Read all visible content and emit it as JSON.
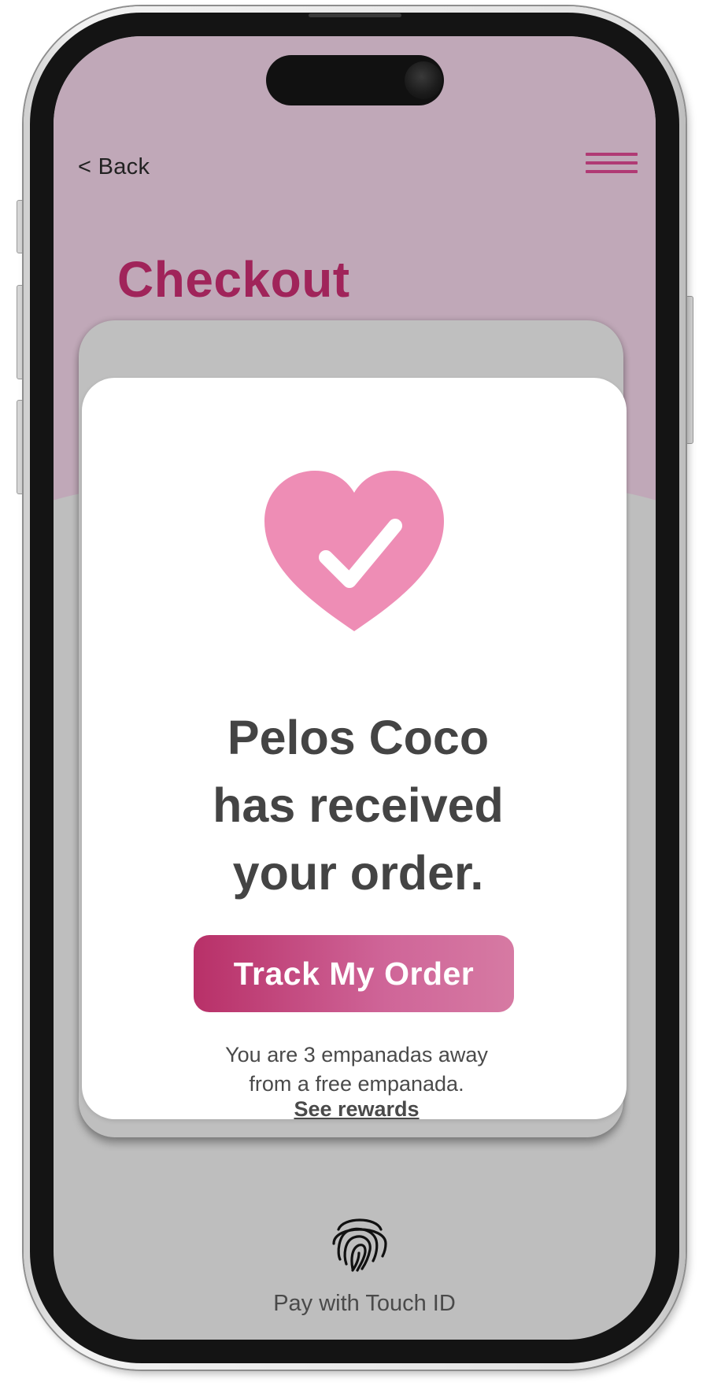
{
  "colors": {
    "header_bg": "#c0a8b8",
    "accent": "#a0245a",
    "menu": "#b03a74",
    "heart": "#ee8db5",
    "button_start": "#b83068",
    "button_end": "#d67aa3",
    "body_text": "#444444",
    "gray": "#bebebe"
  },
  "header": {
    "back_label": "< Back",
    "menu_icon": "hamburger-menu-icon"
  },
  "page": {
    "title": "Checkout"
  },
  "modal": {
    "icon": "heart-checkmark-icon",
    "message_lines": [
      "Pelos Coco",
      "has received",
      "your order."
    ],
    "primary_button": "Track My Order",
    "rewards_lines": [
      "You are 3 empanadas away",
      "from a free empanada."
    ],
    "rewards_link": "See rewards"
  },
  "payment": {
    "icon": "fingerprint-icon",
    "label": "Pay with Touch ID"
  }
}
